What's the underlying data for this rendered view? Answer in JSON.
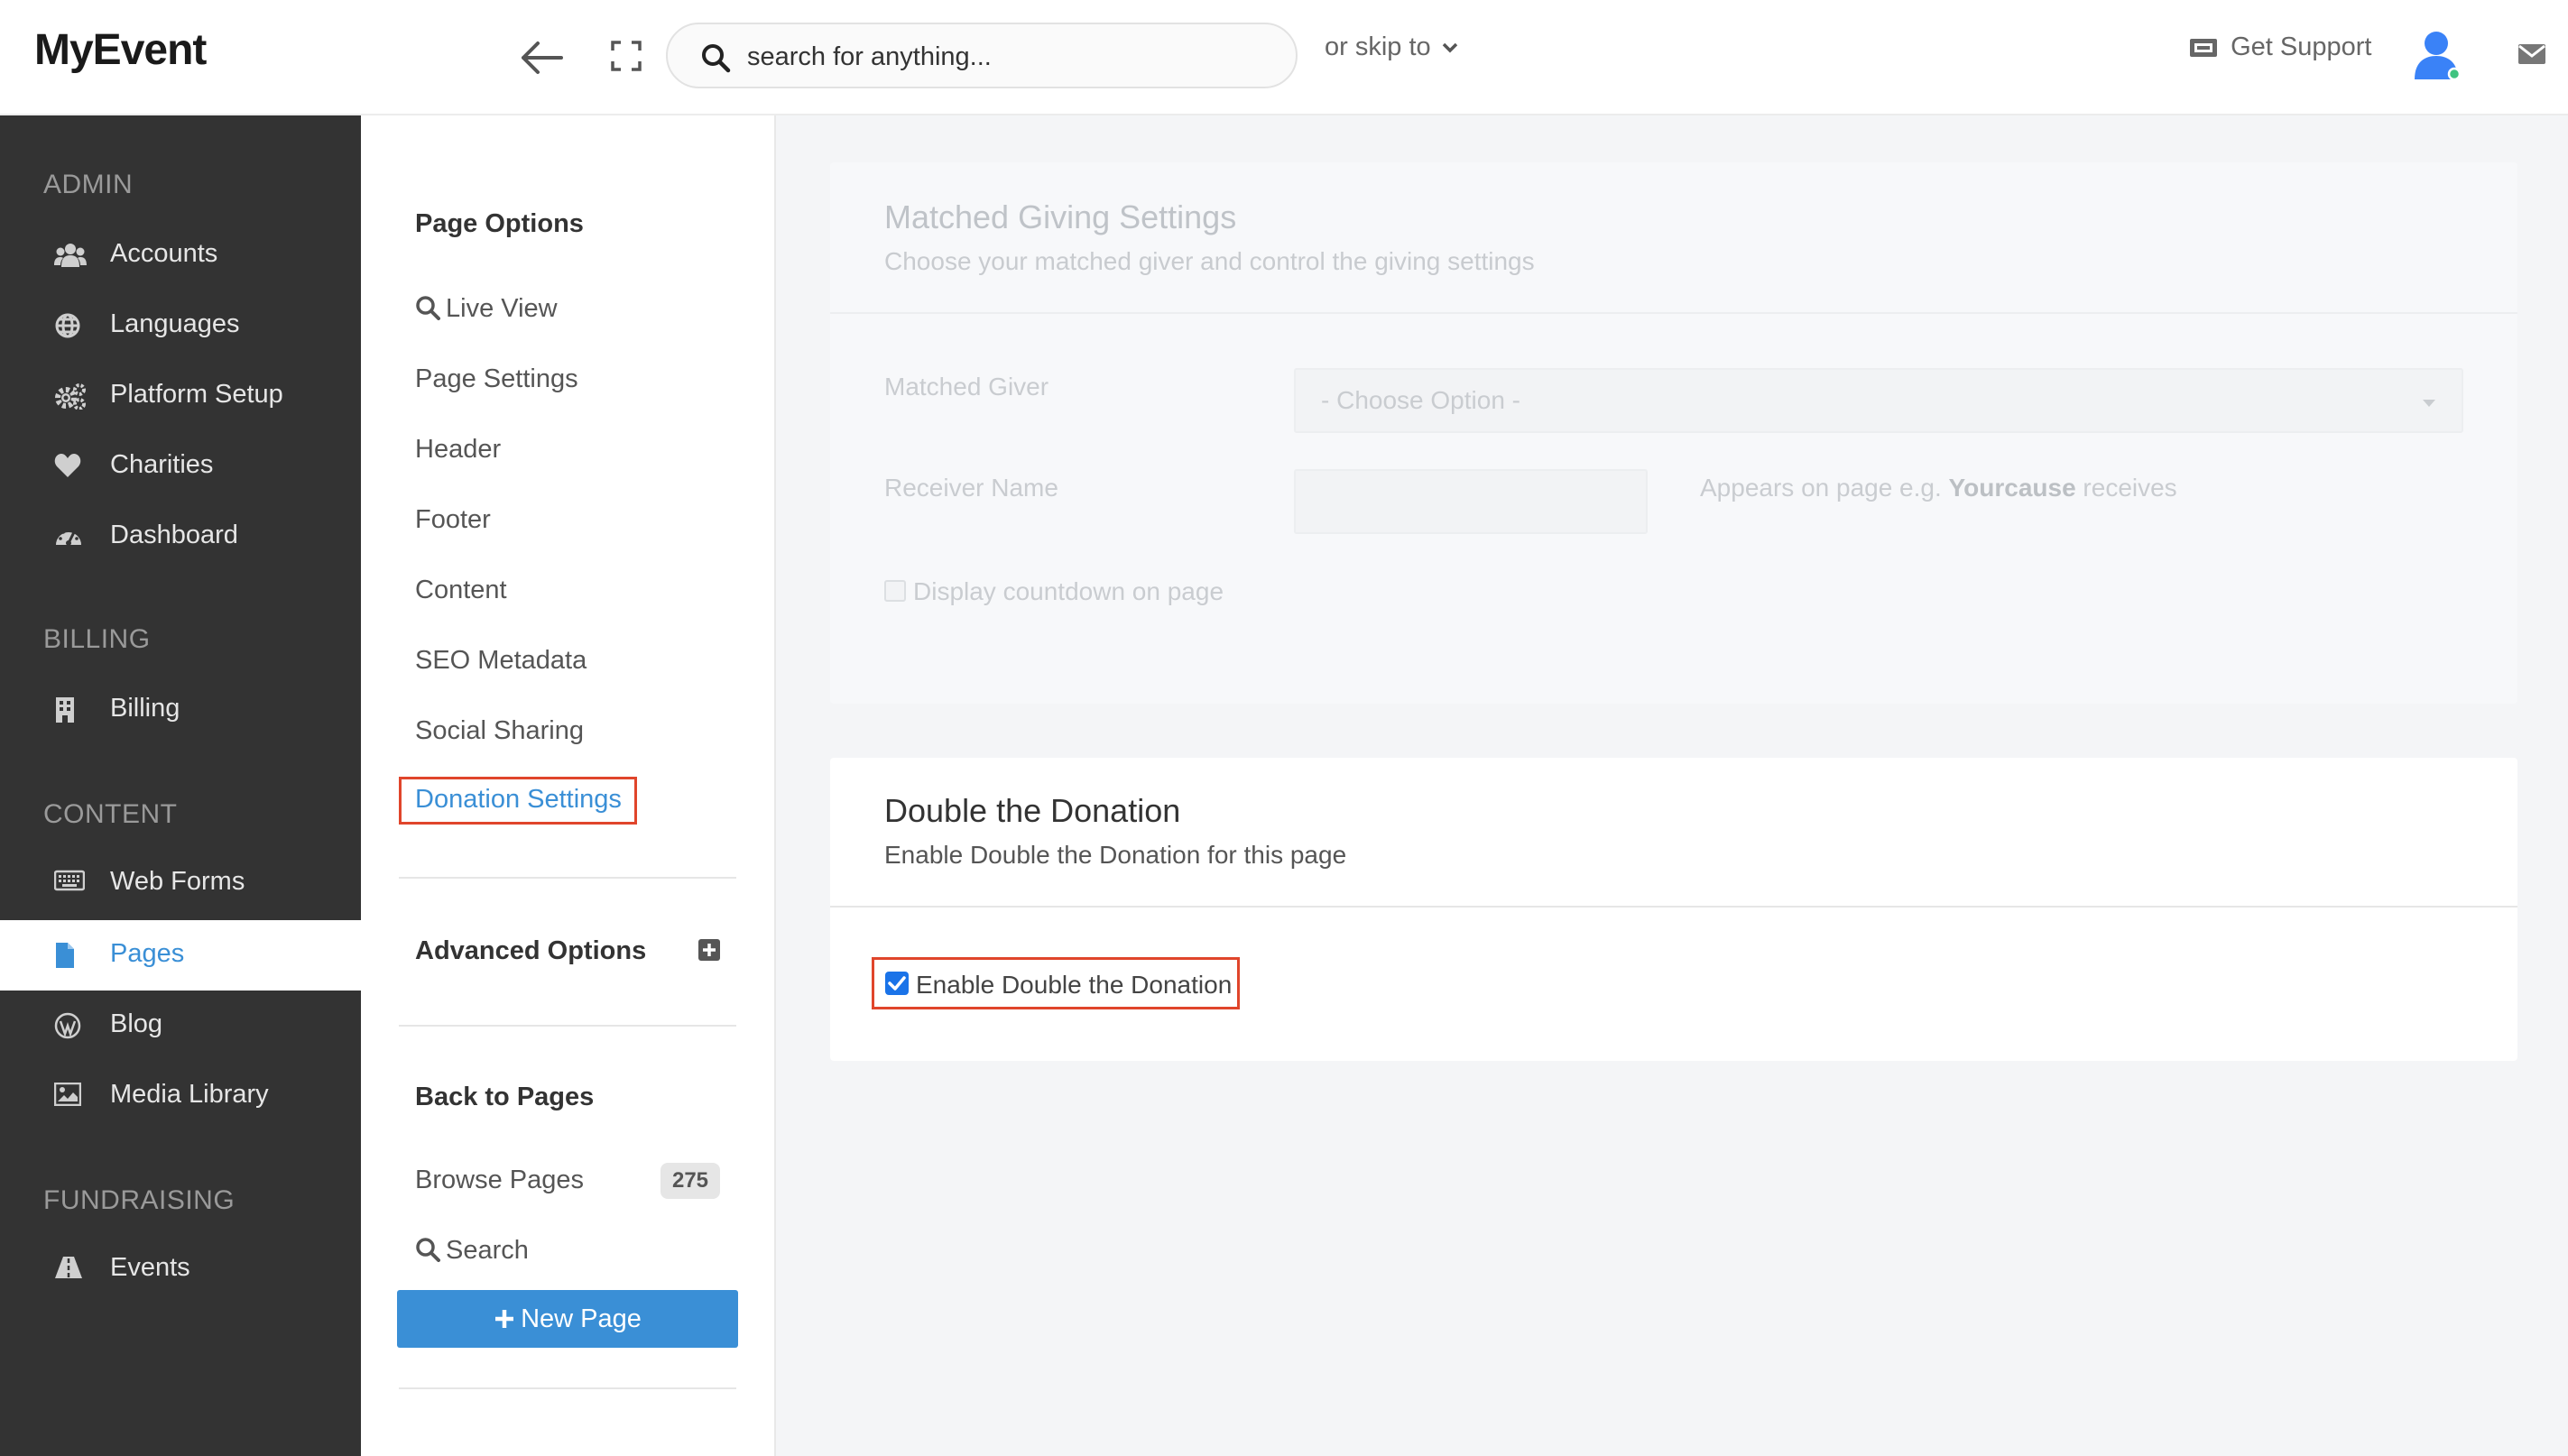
{
  "app": {
    "title": "MyEvent"
  },
  "search": {
    "placeholder": "search for anything..."
  },
  "header": {
    "skip_to": "or skip to",
    "support": "Get Support"
  },
  "sidebar": {
    "sections": [
      {
        "heading": "ADMIN",
        "items": [
          {
            "label": "Accounts",
            "icon": "users-icon"
          },
          {
            "label": "Languages",
            "icon": "globe-icon"
          },
          {
            "label": "Platform Setup",
            "icon": "cogs-icon"
          },
          {
            "label": "Charities",
            "icon": "heart-icon"
          },
          {
            "label": "Dashboard",
            "icon": "dashboard-icon"
          }
        ]
      },
      {
        "heading": "BILLING",
        "items": [
          {
            "label": "Billing",
            "icon": "building-icon"
          }
        ]
      },
      {
        "heading": "CONTENT",
        "items": [
          {
            "label": "Web Forms",
            "icon": "keyboard-icon"
          },
          {
            "label": "Pages",
            "icon": "file-icon",
            "active": true
          },
          {
            "label": "Blog",
            "icon": "wordpress-icon"
          },
          {
            "label": "Media Library",
            "icon": "image-icon"
          }
        ]
      },
      {
        "heading": "FUNDRAISING",
        "items": [
          {
            "label": "Events",
            "icon": "road-icon"
          }
        ]
      }
    ]
  },
  "page_options": {
    "heading": "Page Options",
    "links": [
      "Live View",
      "Page Settings",
      "Header",
      "Footer",
      "Content",
      "SEO Metadata",
      "Social Sharing",
      "Donation Settings"
    ],
    "selected": "Donation Settings",
    "advanced_heading": "Advanced Options",
    "back_heading": "Back to Pages",
    "browse_label": "Browse Pages",
    "browse_count": "275",
    "search_label": "Search",
    "new_page_label": "New Page"
  },
  "matched_giving": {
    "title": "Matched Giving Settings",
    "subtitle": "Choose your matched giver and control the giving settings",
    "matched_giver_label": "Matched Giver",
    "matched_giver_value": "- Choose Option -",
    "receiver_name_label": "Receiver Name",
    "receiver_hint_prefix": "Appears on page e.g.",
    "receiver_hint_example": "Yourcause",
    "receiver_hint_suffix": "receives",
    "countdown_label": "Display countdown on page",
    "countdown_checked": false
  },
  "double_donation": {
    "title": "Double the Donation",
    "subtitle": "Enable Double the Donation for this page",
    "enable_label": "Enable Double the Donation",
    "enabled": true
  },
  "colors": {
    "accent": "#3a8fd6",
    "sidebar_bg": "#333333",
    "highlight": "#e0452b",
    "checkbox": "#1a73e8"
  }
}
